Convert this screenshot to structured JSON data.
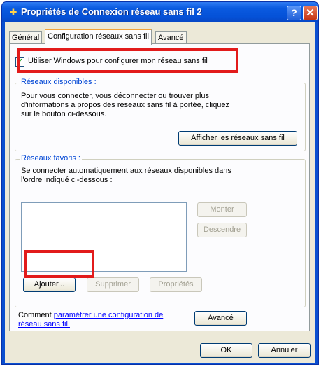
{
  "window": {
    "title": "Propriétés de Connexion réseau sans fil 2",
    "help_label": "?",
    "close_label": "✕"
  },
  "tabs": [
    {
      "label": "Général"
    },
    {
      "label": "Configuration réseaux sans fil"
    },
    {
      "label": "Avancé"
    }
  ],
  "panel": {
    "use_windows_checkbox": {
      "label": "Utiliser Windows pour configurer mon réseau sans fil",
      "checked": true
    },
    "available": {
      "title": "Réseaux disponibles :",
      "description_lines": [
        "Pour vous connecter, vous déconnecter ou trouver plus",
        "d'informations à propos des réseaux sans fil à portée, cliquez",
        "sur le bouton ci-dessous."
      ],
      "show_networks_button": "Afficher les réseaux sans fil"
    },
    "preferred": {
      "title": "Réseaux favoris :",
      "description_lines": [
        "Se connecter automatiquement aux réseaux disponibles dans",
        "l'ordre indiqué ci-dessous :"
      ],
      "up_button": "Monter",
      "down_button": "Descendre",
      "add_button": "Ajouter...",
      "remove_button": "Supprimer",
      "properties_button": "Propriétés"
    },
    "learn_more": {
      "prefix": "Comment ",
      "link_line1": "paramétrer une configuration de",
      "link_line2": "réseau sans fil."
    },
    "advanced_button": "Avancé"
  },
  "footer": {
    "ok_button": "OK",
    "cancel_button": "Annuler"
  },
  "colors": {
    "highlight_box": "#e21b1b",
    "titlebar": "#0552d8",
    "dialog_bg": "#ece9d8"
  }
}
